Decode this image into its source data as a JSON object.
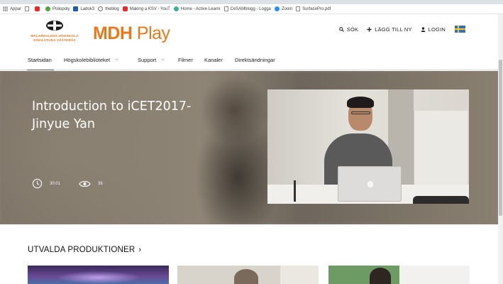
{
  "bookmarks": [
    {
      "label": "Appar",
      "icon": "apps-grid-icon"
    },
    {
      "label": "",
      "icon": "page-icon"
    },
    {
      "label": "",
      "icon": "youtube-icon"
    },
    {
      "label": "Poliopoly",
      "icon": "poliopoly-icon"
    },
    {
      "label": "Ladok3",
      "icon": "ladok-icon"
    },
    {
      "label": "theblog",
      "icon": "blog-icon"
    },
    {
      "label": "Making a KSV - YouT",
      "icon": "youtube-icon"
    },
    {
      "label": "Home - Active Learni",
      "icon": "active-learning-icon"
    },
    {
      "label": "CeSAMblogg - Logga",
      "icon": "page-icon"
    },
    {
      "label": "Zoom",
      "icon": "zoom-icon"
    },
    {
      "label": "SurfacePro.pdf",
      "icon": "page-icon"
    }
  ],
  "header": {
    "logo_line1": "MÄLARDALENS HÖGSKOLA",
    "logo_line2": "ESKILSTUNA VÄSTERÅS",
    "brand_bold": "MDH",
    "brand_light": "Play",
    "search_label": "SÖK",
    "add_label": "LÄGG TILL NY",
    "login_label": "LOGIN",
    "language_flag": "swedish-flag"
  },
  "nav": {
    "items": [
      {
        "label": "Startsidan",
        "dropdown": false,
        "active": true
      },
      {
        "label": "Högskolebiblioteket",
        "dropdown": true,
        "active": false
      },
      {
        "label": "Support",
        "dropdown": true,
        "active": false
      },
      {
        "label": "Filmer",
        "dropdown": false,
        "active": false
      },
      {
        "label": "Kanaler",
        "dropdown": false,
        "active": false
      },
      {
        "label": "Direktsändningar",
        "dropdown": false,
        "active": false
      }
    ]
  },
  "hero": {
    "title": "Introduction to iCET2017- Jinyue Yan",
    "duration": "30:01",
    "views": "36"
  },
  "section": {
    "title": "UTVALDA PRODUKTIONER",
    "arrow": "›"
  },
  "colors": {
    "brand_orange": "#e8791b",
    "hero_bg": "#8a7f72"
  }
}
